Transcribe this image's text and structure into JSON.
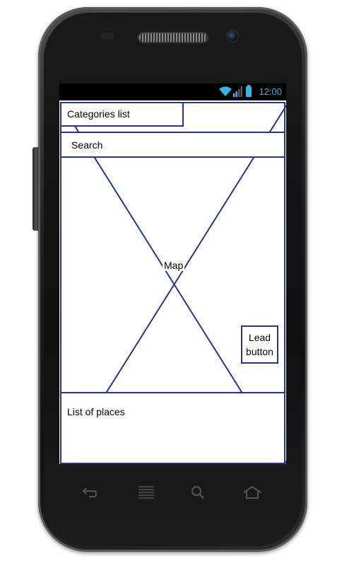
{
  "status_bar": {
    "time": "12:00"
  },
  "wireframe": {
    "categories_label": "Categories list",
    "search_label": "Search",
    "map_label": "Map",
    "lead_button_line1": "Lead",
    "lead_button_line2": "button",
    "places_label": "List of places"
  },
  "icons": {
    "wifi": "wifi-icon",
    "signal": "signal-icon",
    "battery": "battery-icon",
    "back": "back-icon",
    "menu": "menu-icon",
    "search": "search-icon",
    "home": "home-icon"
  },
  "colors": {
    "wireframe_border": "#27358f",
    "status_accent": "#33b5e5"
  }
}
